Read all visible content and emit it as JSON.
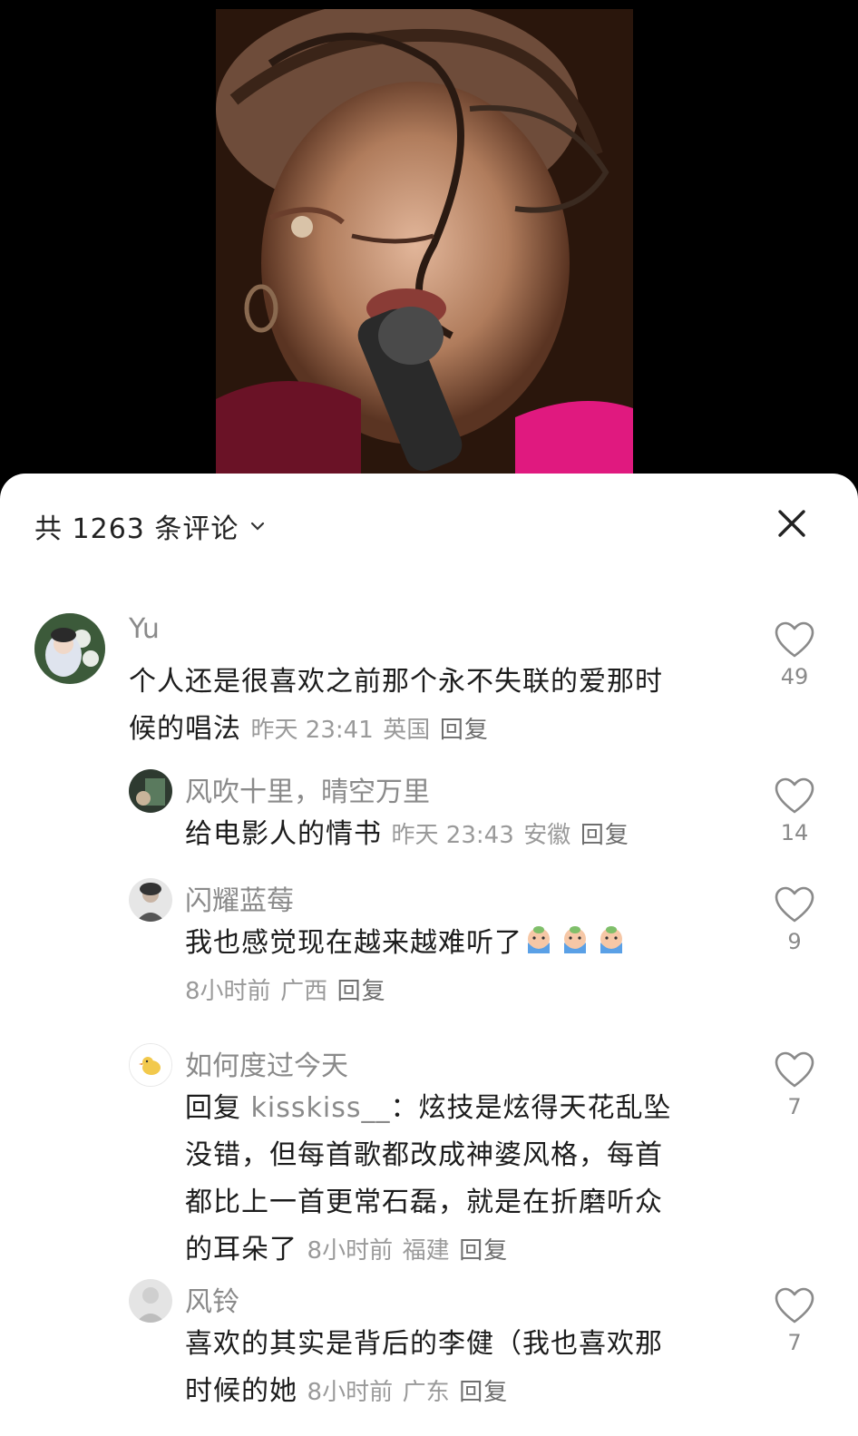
{
  "header": {
    "title": "共 1263 条评论"
  },
  "comments": [
    {
      "username": "Yu",
      "text": "个人还是很喜欢之前那个永不失联的爱那时候的唱法",
      "line1": "个人还是很喜欢之前那个永不失联的爱那时",
      "line2": "候的唱法",
      "time": "昨天 23:41",
      "location": "英国",
      "reply": "回复",
      "likes": "49"
    },
    {
      "username": "风吹十里，晴空万里",
      "text": "给电影人的情书",
      "time": "昨天 23:43",
      "location": "安徽",
      "reply": "回复",
      "likes": "14"
    },
    {
      "username": "闪耀蓝莓",
      "text": "我也感觉现在越来越难听了",
      "emoji_count": 3,
      "time": "8小时前",
      "location": "广西",
      "reply": "回复",
      "likes": "9"
    },
    {
      "username": "如何度过今天",
      "reply_prefix": "回复",
      "reply_to": "kisskiss__",
      "colon": "：",
      "line1": "炫技是炫得天花乱坠",
      "line2": "没错，但每首歌都改成神婆风格，每首",
      "line3": "都比上一首更常石磊，就是在折磨听众",
      "line4": "的耳朵了",
      "time": "8小时前",
      "location": "福建",
      "reply": "回复",
      "likes": "7"
    },
    {
      "username": "风铃",
      "line1": "喜欢的其实是背后的李健（我也喜欢那",
      "line2": "时候的她",
      "time": "8小时前",
      "location": "广东",
      "reply": "回复",
      "likes": "7"
    }
  ],
  "colors": {
    "accent_magenta": "#e0197f",
    "text_primary": "#1c1c1c",
    "text_secondary": "#8a8a8a"
  }
}
